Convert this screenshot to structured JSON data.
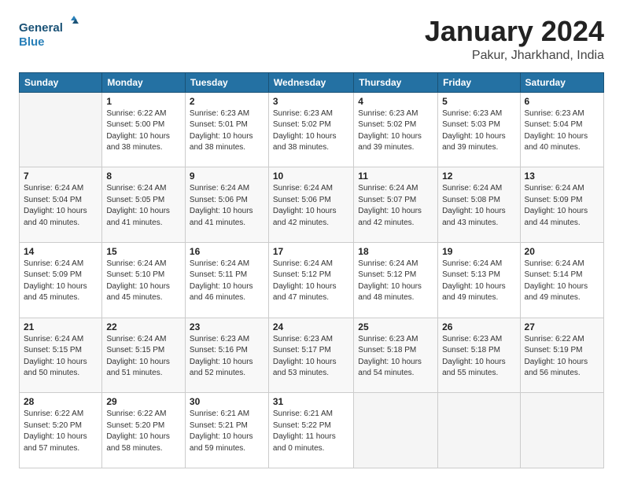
{
  "header": {
    "logo_line1": "General",
    "logo_line2": "Blue",
    "month": "January 2024",
    "location": "Pakur, Jharkhand, India"
  },
  "weekdays": [
    "Sunday",
    "Monday",
    "Tuesday",
    "Wednesday",
    "Thursday",
    "Friday",
    "Saturday"
  ],
  "weeks": [
    [
      {
        "day": "",
        "info": ""
      },
      {
        "day": "1",
        "info": "Sunrise: 6:22 AM\nSunset: 5:00 PM\nDaylight: 10 hours\nand 38 minutes."
      },
      {
        "day": "2",
        "info": "Sunrise: 6:23 AM\nSunset: 5:01 PM\nDaylight: 10 hours\nand 38 minutes."
      },
      {
        "day": "3",
        "info": "Sunrise: 6:23 AM\nSunset: 5:02 PM\nDaylight: 10 hours\nand 38 minutes."
      },
      {
        "day": "4",
        "info": "Sunrise: 6:23 AM\nSunset: 5:02 PM\nDaylight: 10 hours\nand 39 minutes."
      },
      {
        "day": "5",
        "info": "Sunrise: 6:23 AM\nSunset: 5:03 PM\nDaylight: 10 hours\nand 39 minutes."
      },
      {
        "day": "6",
        "info": "Sunrise: 6:23 AM\nSunset: 5:04 PM\nDaylight: 10 hours\nand 40 minutes."
      }
    ],
    [
      {
        "day": "7",
        "info": "Sunrise: 6:24 AM\nSunset: 5:04 PM\nDaylight: 10 hours\nand 40 minutes."
      },
      {
        "day": "8",
        "info": "Sunrise: 6:24 AM\nSunset: 5:05 PM\nDaylight: 10 hours\nand 41 minutes."
      },
      {
        "day": "9",
        "info": "Sunrise: 6:24 AM\nSunset: 5:06 PM\nDaylight: 10 hours\nand 41 minutes."
      },
      {
        "day": "10",
        "info": "Sunrise: 6:24 AM\nSunset: 5:06 PM\nDaylight: 10 hours\nand 42 minutes."
      },
      {
        "day": "11",
        "info": "Sunrise: 6:24 AM\nSunset: 5:07 PM\nDaylight: 10 hours\nand 42 minutes."
      },
      {
        "day": "12",
        "info": "Sunrise: 6:24 AM\nSunset: 5:08 PM\nDaylight: 10 hours\nand 43 minutes."
      },
      {
        "day": "13",
        "info": "Sunrise: 6:24 AM\nSunset: 5:09 PM\nDaylight: 10 hours\nand 44 minutes."
      }
    ],
    [
      {
        "day": "14",
        "info": "Sunrise: 6:24 AM\nSunset: 5:09 PM\nDaylight: 10 hours\nand 45 minutes."
      },
      {
        "day": "15",
        "info": "Sunrise: 6:24 AM\nSunset: 5:10 PM\nDaylight: 10 hours\nand 45 minutes."
      },
      {
        "day": "16",
        "info": "Sunrise: 6:24 AM\nSunset: 5:11 PM\nDaylight: 10 hours\nand 46 minutes."
      },
      {
        "day": "17",
        "info": "Sunrise: 6:24 AM\nSunset: 5:12 PM\nDaylight: 10 hours\nand 47 minutes."
      },
      {
        "day": "18",
        "info": "Sunrise: 6:24 AM\nSunset: 5:12 PM\nDaylight: 10 hours\nand 48 minutes."
      },
      {
        "day": "19",
        "info": "Sunrise: 6:24 AM\nSunset: 5:13 PM\nDaylight: 10 hours\nand 49 minutes."
      },
      {
        "day": "20",
        "info": "Sunrise: 6:24 AM\nSunset: 5:14 PM\nDaylight: 10 hours\nand 49 minutes."
      }
    ],
    [
      {
        "day": "21",
        "info": "Sunrise: 6:24 AM\nSunset: 5:15 PM\nDaylight: 10 hours\nand 50 minutes."
      },
      {
        "day": "22",
        "info": "Sunrise: 6:24 AM\nSunset: 5:15 PM\nDaylight: 10 hours\nand 51 minutes."
      },
      {
        "day": "23",
        "info": "Sunrise: 6:23 AM\nSunset: 5:16 PM\nDaylight: 10 hours\nand 52 minutes."
      },
      {
        "day": "24",
        "info": "Sunrise: 6:23 AM\nSunset: 5:17 PM\nDaylight: 10 hours\nand 53 minutes."
      },
      {
        "day": "25",
        "info": "Sunrise: 6:23 AM\nSunset: 5:18 PM\nDaylight: 10 hours\nand 54 minutes."
      },
      {
        "day": "26",
        "info": "Sunrise: 6:23 AM\nSunset: 5:18 PM\nDaylight: 10 hours\nand 55 minutes."
      },
      {
        "day": "27",
        "info": "Sunrise: 6:22 AM\nSunset: 5:19 PM\nDaylight: 10 hours\nand 56 minutes."
      }
    ],
    [
      {
        "day": "28",
        "info": "Sunrise: 6:22 AM\nSunset: 5:20 PM\nDaylight: 10 hours\nand 57 minutes."
      },
      {
        "day": "29",
        "info": "Sunrise: 6:22 AM\nSunset: 5:20 PM\nDaylight: 10 hours\nand 58 minutes."
      },
      {
        "day": "30",
        "info": "Sunrise: 6:21 AM\nSunset: 5:21 PM\nDaylight: 10 hours\nand 59 minutes."
      },
      {
        "day": "31",
        "info": "Sunrise: 6:21 AM\nSunset: 5:22 PM\nDaylight: 11 hours\nand 0 minutes."
      },
      {
        "day": "",
        "info": ""
      },
      {
        "day": "",
        "info": ""
      },
      {
        "day": "",
        "info": ""
      }
    ]
  ]
}
